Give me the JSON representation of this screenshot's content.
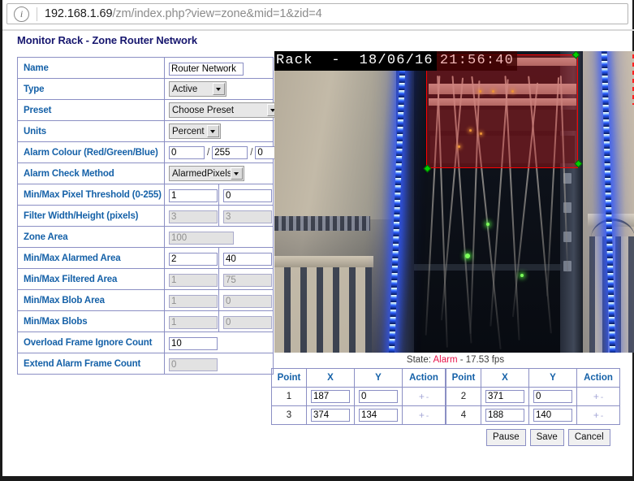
{
  "browser": {
    "info_icon": "info-icon",
    "url_host": "192.168.1.69",
    "url_path": "/zm/index.php?view=zone&mid=1&zid=4"
  },
  "page": {
    "title": "Monitor Rack - Zone Router Network"
  },
  "form": {
    "rows": [
      {
        "label": "Name",
        "value": "Router Network"
      },
      {
        "label": "Type",
        "value": "Active"
      },
      {
        "label": "Preset",
        "value": "Choose Preset"
      },
      {
        "label": "Units",
        "value": "Percent"
      },
      {
        "label": "Alarm Colour (Red/Green/Blue)",
        "red": "0",
        "green": "255",
        "blue": "0",
        "sep": "/"
      },
      {
        "label": "Alarm Check Method",
        "value": "AlarmedPixels"
      },
      {
        "label": "Min/Max Pixel Threshold (0-255)",
        "min": "1",
        "max": "0"
      },
      {
        "label": "Filter Width/Height (pixels)",
        "min": "3",
        "max": "3"
      },
      {
        "label": "Zone Area",
        "value": "100"
      },
      {
        "label": "Min/Max Alarmed Area",
        "min": "2",
        "max": "40"
      },
      {
        "label": "Min/Max Filtered Area",
        "min": "1",
        "max": "75"
      },
      {
        "label": "Min/Max Blob Area",
        "min": "1",
        "max": "0"
      },
      {
        "label": "Min/Max Blobs",
        "min": "1",
        "max": "0"
      },
      {
        "label": "Overload Frame Ignore Count",
        "value": "10"
      },
      {
        "label": "Extend Alarm Frame Count",
        "value": "0"
      }
    ],
    "options": {
      "type": [
        "Active"
      ],
      "preset": [
        "Choose Preset"
      ],
      "units": [
        "Percent"
      ],
      "method": [
        "AlarmedPixels"
      ]
    }
  },
  "video": {
    "overlay_label": "Rack  -  18/06/16",
    "overlay_time": "21:56:40",
    "zone_color": "#ff0000",
    "handle_color": "#00d100"
  },
  "status": {
    "prefix": "State: ",
    "state": "Alarm",
    "suffix": " - 17.53 fps",
    "state_color": "#e8134a"
  },
  "points": {
    "headers": [
      "Point",
      "X",
      "Y",
      "Action"
    ],
    "add_label": "+",
    "remove_label": "-",
    "left": [
      {
        "index": "1",
        "x": "187",
        "y": "0"
      },
      {
        "index": "3",
        "x": "374",
        "y": "134"
      }
    ],
    "right": [
      {
        "index": "2",
        "x": "371",
        "y": "0"
      },
      {
        "index": "4",
        "x": "188",
        "y": "140"
      }
    ]
  },
  "buttons": {
    "pause": "Pause",
    "save": "Save",
    "cancel": "Cancel"
  }
}
